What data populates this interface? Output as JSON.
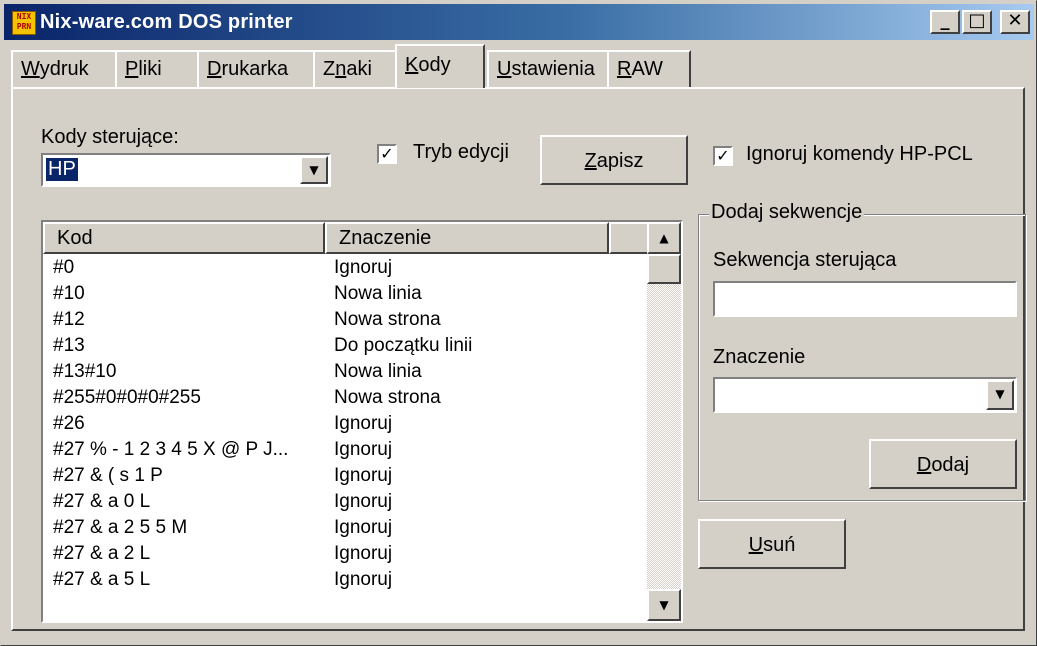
{
  "window": {
    "title": "Nix-ware.com DOS printer",
    "icon_text": "NIX PRN",
    "controls": {
      "minimize": "_",
      "maximize": "□",
      "close": "✕"
    }
  },
  "tabs": [
    {
      "label": "Wydruk",
      "hotkey": "W",
      "rest": "ydruk"
    },
    {
      "label": "Pliki",
      "hotkey": "P",
      "rest": "liki"
    },
    {
      "label": "Drukarka",
      "hotkey": "D",
      "rest": "rukarka"
    },
    {
      "label": "Znaki",
      "pre": "Z",
      "hotkey": "n",
      "rest": "aki"
    },
    {
      "label": "Kody",
      "hotkey": "K",
      "rest": "ody",
      "active": true
    },
    {
      "label": "Ustawienia",
      "hotkey": "U",
      "rest": "stawienia"
    },
    {
      "label": "RAW",
      "hotkey": "R",
      "rest": "AW"
    }
  ],
  "kody": {
    "combo_label": "Kody sterujące:",
    "combo_value": "HP",
    "edit_mode_label": "Tryb edycji",
    "edit_mode_checked": true,
    "save_hotkey": "Z",
    "save_rest": "apisz",
    "ignore_hp_label": "Ignoruj komendy HP-PCL",
    "ignore_hp_checked": true
  },
  "table": {
    "headers": [
      "Kod",
      "Znaczenie"
    ],
    "rows": [
      [
        "#0",
        "Ignoruj"
      ],
      [
        "#10",
        "Nowa linia"
      ],
      [
        "#12",
        "Nowa strona"
      ],
      [
        "#13",
        "Do początku linii"
      ],
      [
        "#13#10",
        "Nowa linia"
      ],
      [
        "#255#0#0#0#255",
        "Nowa strona"
      ],
      [
        "#26",
        "Ignoruj"
      ],
      [
        "#27 % - 1 2 3 4 5 X @ P J...",
        "Ignoruj"
      ],
      [
        "#27 & ( s 1 P",
        "Ignoruj"
      ],
      [
        "#27 & a 0 L",
        "Ignoruj"
      ],
      [
        "#27 & a 2 5 5 M",
        "Ignoruj"
      ],
      [
        "#27 & a 2 L",
        "Ignoruj"
      ],
      [
        "#27 & a 5 L",
        "Ignoruj"
      ]
    ]
  },
  "add_sequence": {
    "group_title": "Dodaj sekwencje",
    "sequence_label": "Sekwencja sterująca",
    "sequence_value": "",
    "meaning_label": "Znaczenie",
    "meaning_value": "",
    "add_hotkey": "D",
    "add_rest": "odaj"
  },
  "remove": {
    "hotkey": "U",
    "rest": "suń"
  }
}
